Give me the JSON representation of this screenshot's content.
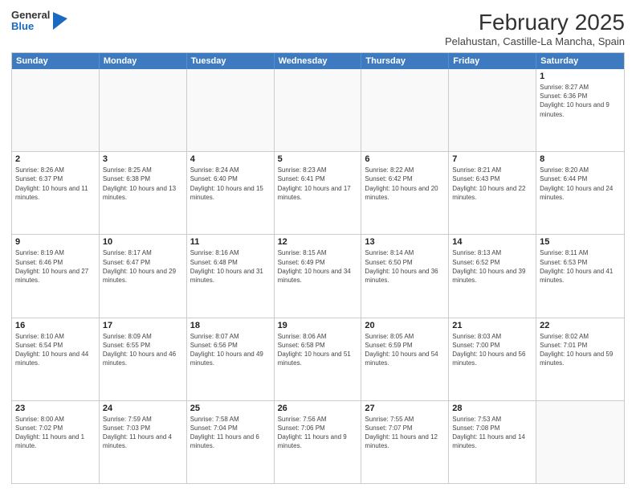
{
  "header": {
    "logo": {
      "general": "General",
      "blue": "Blue"
    },
    "title": "February 2025",
    "subtitle": "Pelahustan, Castille-La Mancha, Spain"
  },
  "calendar": {
    "weekdays": [
      "Sunday",
      "Monday",
      "Tuesday",
      "Wednesday",
      "Thursday",
      "Friday",
      "Saturday"
    ],
    "rows": [
      [
        {
          "day": "",
          "empty": true
        },
        {
          "day": "",
          "empty": true
        },
        {
          "day": "",
          "empty": true
        },
        {
          "day": "",
          "empty": true
        },
        {
          "day": "",
          "empty": true
        },
        {
          "day": "",
          "empty": true
        },
        {
          "day": "1",
          "sunrise": "8:27 AM",
          "sunset": "6:36 PM",
          "daylight": "10 hours and 9 minutes."
        }
      ],
      [
        {
          "day": "2",
          "sunrise": "8:26 AM",
          "sunset": "6:37 PM",
          "daylight": "10 hours and 11 minutes."
        },
        {
          "day": "3",
          "sunrise": "8:25 AM",
          "sunset": "6:38 PM",
          "daylight": "10 hours and 13 minutes."
        },
        {
          "day": "4",
          "sunrise": "8:24 AM",
          "sunset": "6:40 PM",
          "daylight": "10 hours and 15 minutes."
        },
        {
          "day": "5",
          "sunrise": "8:23 AM",
          "sunset": "6:41 PM",
          "daylight": "10 hours and 17 minutes."
        },
        {
          "day": "6",
          "sunrise": "8:22 AM",
          "sunset": "6:42 PM",
          "daylight": "10 hours and 20 minutes."
        },
        {
          "day": "7",
          "sunrise": "8:21 AM",
          "sunset": "6:43 PM",
          "daylight": "10 hours and 22 minutes."
        },
        {
          "day": "8",
          "sunrise": "8:20 AM",
          "sunset": "6:44 PM",
          "daylight": "10 hours and 24 minutes."
        }
      ],
      [
        {
          "day": "9",
          "sunrise": "8:19 AM",
          "sunset": "6:46 PM",
          "daylight": "10 hours and 27 minutes."
        },
        {
          "day": "10",
          "sunrise": "8:17 AM",
          "sunset": "6:47 PM",
          "daylight": "10 hours and 29 minutes."
        },
        {
          "day": "11",
          "sunrise": "8:16 AM",
          "sunset": "6:48 PM",
          "daylight": "10 hours and 31 minutes."
        },
        {
          "day": "12",
          "sunrise": "8:15 AM",
          "sunset": "6:49 PM",
          "daylight": "10 hours and 34 minutes."
        },
        {
          "day": "13",
          "sunrise": "8:14 AM",
          "sunset": "6:50 PM",
          "daylight": "10 hours and 36 minutes."
        },
        {
          "day": "14",
          "sunrise": "8:13 AM",
          "sunset": "6:52 PM",
          "daylight": "10 hours and 39 minutes."
        },
        {
          "day": "15",
          "sunrise": "8:11 AM",
          "sunset": "6:53 PM",
          "daylight": "10 hours and 41 minutes."
        }
      ],
      [
        {
          "day": "16",
          "sunrise": "8:10 AM",
          "sunset": "6:54 PM",
          "daylight": "10 hours and 44 minutes."
        },
        {
          "day": "17",
          "sunrise": "8:09 AM",
          "sunset": "6:55 PM",
          "daylight": "10 hours and 46 minutes."
        },
        {
          "day": "18",
          "sunrise": "8:07 AM",
          "sunset": "6:56 PM",
          "daylight": "10 hours and 49 minutes."
        },
        {
          "day": "19",
          "sunrise": "8:06 AM",
          "sunset": "6:58 PM",
          "daylight": "10 hours and 51 minutes."
        },
        {
          "day": "20",
          "sunrise": "8:05 AM",
          "sunset": "6:59 PM",
          "daylight": "10 hours and 54 minutes."
        },
        {
          "day": "21",
          "sunrise": "8:03 AM",
          "sunset": "7:00 PM",
          "daylight": "10 hours and 56 minutes."
        },
        {
          "day": "22",
          "sunrise": "8:02 AM",
          "sunset": "7:01 PM",
          "daylight": "10 hours and 59 minutes."
        }
      ],
      [
        {
          "day": "23",
          "sunrise": "8:00 AM",
          "sunset": "7:02 PM",
          "daylight": "11 hours and 1 minute."
        },
        {
          "day": "24",
          "sunrise": "7:59 AM",
          "sunset": "7:03 PM",
          "daylight": "11 hours and 4 minutes."
        },
        {
          "day": "25",
          "sunrise": "7:58 AM",
          "sunset": "7:04 PM",
          "daylight": "11 hours and 6 minutes."
        },
        {
          "day": "26",
          "sunrise": "7:56 AM",
          "sunset": "7:06 PM",
          "daylight": "11 hours and 9 minutes."
        },
        {
          "day": "27",
          "sunrise": "7:55 AM",
          "sunset": "7:07 PM",
          "daylight": "11 hours and 12 minutes."
        },
        {
          "day": "28",
          "sunrise": "7:53 AM",
          "sunset": "7:08 PM",
          "daylight": "11 hours and 14 minutes."
        },
        {
          "day": "",
          "empty": true
        }
      ]
    ]
  }
}
